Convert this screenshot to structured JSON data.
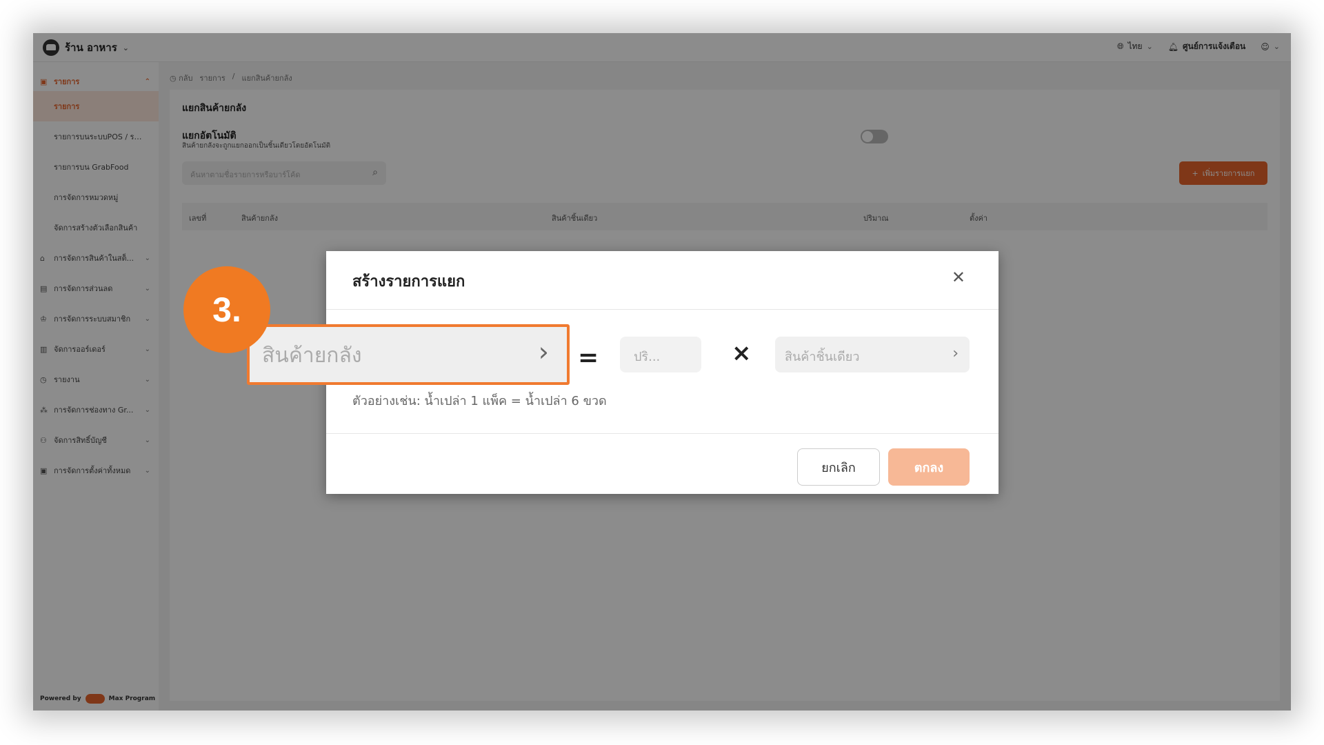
{
  "topbar": {
    "store_name": "ร้าน อาหาร",
    "language": "ไทย",
    "notifications": "ศูนย์การแจ้งเตือน"
  },
  "sidebar": {
    "section": "รายการ",
    "items": [
      {
        "label": "รายการ"
      },
      {
        "label": "รายการบนระบบPOS / ระ..."
      },
      {
        "label": "รายการบน GrabFood"
      },
      {
        "label": "การจัดการหมวดหมู่"
      },
      {
        "label": "จัดการสร้างตัวเลือกสินค้า"
      }
    ],
    "groups": [
      {
        "label": "การจัดการสินค้าในสต็..."
      },
      {
        "label": "การจัดการส่วนลด"
      },
      {
        "label": "การจัดการระบบสมาชิก"
      },
      {
        "label": "จัดการออร์เดอร์"
      },
      {
        "label": "รายงาน"
      },
      {
        "label": "การจัดการช่องทาง Gr..."
      },
      {
        "label": "จัดการสิทธิ์บัญชี"
      },
      {
        "label": "การจัดการตั้งค่าทั้งหมด"
      }
    ],
    "powered_by": "Powered by",
    "brand": "Max Program"
  },
  "breadcrumb": {
    "back": "กลับ",
    "path1": "รายการ",
    "sep": "/",
    "path2": "แยกสินค้ายกลัง"
  },
  "page": {
    "title": "แยกสินค้ายกลัง",
    "auto_title": "แยกอัตโนมัติ",
    "auto_desc": "สินค้ายกลังจะถูกแยกออกเป็นชิ้นเดียวโดยอัตโนมัติ",
    "search_placeholder": "ค้นหาตามชื่อรายการหรือบาร์โค้ด",
    "add_button": "เพิ่มรายการแยก",
    "columns": [
      "เลขที่",
      "สินค้ายกลัง",
      "สินค้าชิ้นเดียว",
      "ปริมาณ",
      "ตั้งค่า"
    ]
  },
  "modal": {
    "title": "สร้างรายการแยก",
    "bulk_placeholder": "สินค้ายกลัง",
    "equals": "=",
    "qty_placeholder": "ปริ...",
    "times": "×",
    "single_placeholder": "สินค้าชิ้นเดียว",
    "example": "ตัวอย่างเช่น: น้ำเปล่า 1 แพ็ค = น้ำเปล่า 6 ขวด",
    "cancel": "ยกเลิก",
    "ok": "ตกลง"
  },
  "step_badge": "3.",
  "colors": {
    "accent": "#e8642c",
    "badge": "#f07a22",
    "ok_disabled": "#f7b896"
  }
}
